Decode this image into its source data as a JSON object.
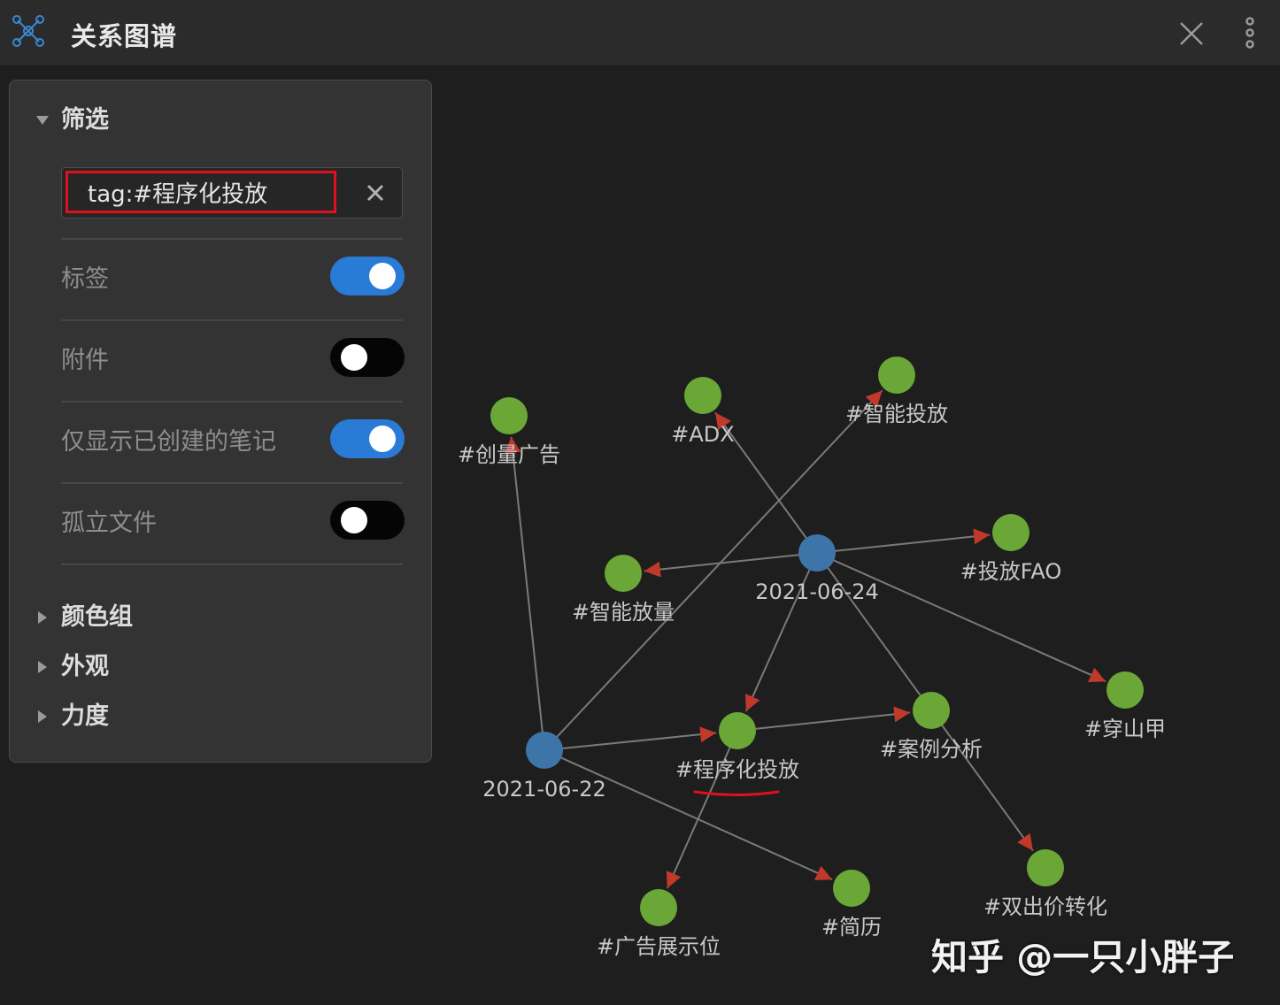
{
  "window": {
    "title": "关系图谱",
    "icons": {
      "app": "graph-network-icon",
      "close": "close-icon",
      "more": "more-vertical-icon"
    }
  },
  "filter_panel": {
    "filter_section": "筛选",
    "search": {
      "value": "tag:#程序化投放",
      "clear_icon": "clear-x-icon"
    },
    "options": [
      {
        "label": "标签",
        "enabled": true
      },
      {
        "label": "附件",
        "enabled": false
      },
      {
        "label": "仅显示已创建的笔记",
        "enabled": true
      },
      {
        "label": "孤立文件",
        "enabled": false
      }
    ],
    "collapsed_sections": [
      "颜色组",
      "外观",
      "力度"
    ]
  },
  "graph": {
    "colors": {
      "note": "#3d75a8",
      "tag": "#6aa737",
      "edge": "#7a7a7a",
      "arrow": "#c0392b",
      "label": "#c8c8c8",
      "highlight_underline": "#e0101c"
    },
    "nodes": [
      {
        "id": "n0622",
        "label": "2021-06-22",
        "kind": "note"
      },
      {
        "id": "n0624",
        "label": "2021-06-24",
        "kind": "note"
      },
      {
        "id": "t_cyggg",
        "label": "#创量广告",
        "kind": "tag"
      },
      {
        "id": "t_adx",
        "label": "#ADX",
        "kind": "tag"
      },
      {
        "id": "t_zntf",
        "label": "#智能投放",
        "kind": "tag"
      },
      {
        "id": "t_tffao",
        "label": "#投放FAO",
        "kind": "tag"
      },
      {
        "id": "t_znfl",
        "label": "#智能放量",
        "kind": "tag"
      },
      {
        "id": "t_cxhtf",
        "label": "#程序化投放",
        "kind": "tag",
        "highlighted": true
      },
      {
        "id": "t_alfx",
        "label": "#案例分析",
        "kind": "tag"
      },
      {
        "id": "t_csj",
        "label": "#穿山甲",
        "kind": "tag"
      },
      {
        "id": "t_sczh",
        "label": "#双出价转化",
        "kind": "tag"
      },
      {
        "id": "t_ggzsw",
        "label": "#广告展示位",
        "kind": "tag"
      },
      {
        "id": "t_jl",
        "label": "#简历",
        "kind": "tag"
      }
    ],
    "edges": [
      [
        "n0622",
        "t_cyggg"
      ],
      [
        "n0622",
        "t_zntf"
      ],
      [
        "n0622",
        "t_cxhtf"
      ],
      [
        "n0622",
        "t_jl"
      ],
      [
        "n0624",
        "t_adx"
      ],
      [
        "n0624",
        "t_tffao"
      ],
      [
        "n0624",
        "t_znfl"
      ],
      [
        "n0624",
        "t_cxhtf"
      ],
      [
        "n0624",
        "t_csj"
      ],
      [
        "n0624",
        "t_sczh"
      ],
      [
        "t_cxhtf",
        "t_alfx"
      ],
      [
        "t_cxhtf",
        "t_ggzsw"
      ]
    ]
  },
  "watermark": "知乎 @一只小胖子"
}
